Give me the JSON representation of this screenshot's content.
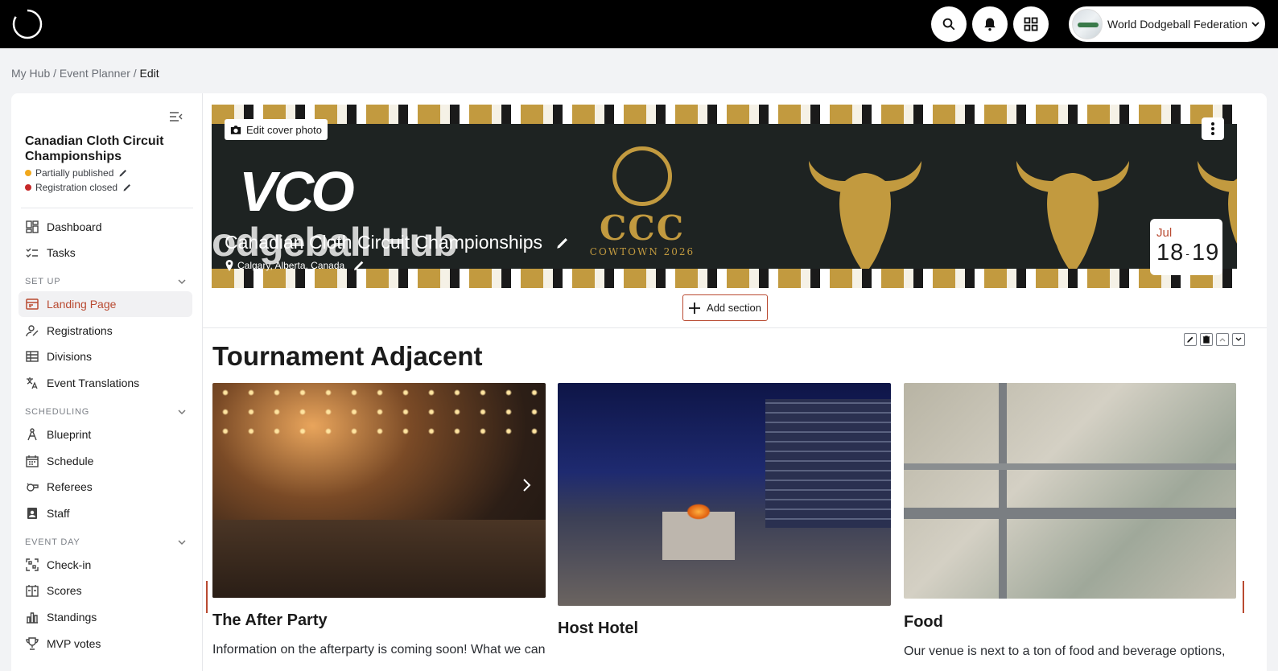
{
  "topbar": {
    "org_name": "World Dodgeball Federation",
    "icons": [
      "loading-logo-icon",
      "search-icon",
      "bell-icon",
      "apps-grid-icon",
      "chevron-down-icon"
    ]
  },
  "breadcrumb": {
    "items": [
      "My Hub",
      "Event Planner"
    ],
    "current": "Edit"
  },
  "sidebar": {
    "event_title": "Canadian Cloth Circuit Championships",
    "status_published": "Partially published",
    "status_registration": "Registration closed",
    "top_items": [
      {
        "label": "Dashboard",
        "icon": "dashboard-icon"
      },
      {
        "label": "Tasks",
        "icon": "tasks-icon"
      }
    ],
    "sections": [
      {
        "title": "SET UP",
        "items": [
          {
            "label": "Landing Page",
            "icon": "landing-page-icon",
            "active": true
          },
          {
            "label": "Registrations",
            "icon": "registrations-icon"
          },
          {
            "label": "Divisions",
            "icon": "divisions-icon"
          },
          {
            "label": "Event Translations",
            "icon": "translate-icon"
          }
        ]
      },
      {
        "title": "SCHEDULING",
        "items": [
          {
            "label": "Blueprint",
            "icon": "blueprint-icon"
          },
          {
            "label": "Schedule",
            "icon": "calendar-icon"
          },
          {
            "label": "Referees",
            "icon": "whistle-icon"
          },
          {
            "label": "Staff",
            "icon": "staff-badge-icon"
          }
        ]
      },
      {
        "title": "EVENT DAY",
        "items": [
          {
            "label": "Check-in",
            "icon": "qr-icon"
          },
          {
            "label": "Scores",
            "icon": "scoreboard-icon"
          },
          {
            "label": "Standings",
            "icon": "bar-chart-icon"
          },
          {
            "label": "MVP votes",
            "icon": "trophy-icon"
          }
        ]
      }
    ]
  },
  "cover": {
    "edit_label": "Edit cover photo",
    "event_name": "Canadian Cloth Circuit Championships",
    "location": "Calgary, Alberta, Canada",
    "date_month": "Jul",
    "date_start": "18",
    "date_sep": "-",
    "date_end": "19",
    "art_vco": "VCO",
    "art_hub": "odgeball Hub",
    "art_ccc": "CCC",
    "art_cowtown": "COWTOWN 2026",
    "colors": {
      "gold": "#c29a3f",
      "dark": "#1e2322",
      "accent": "#b94a31"
    }
  },
  "add_section_label": "Add section",
  "section": {
    "title": "Tournament Adjacent",
    "columns": [
      {
        "title": "The After Party",
        "text": "Information on the afterparty is coming soon! What we can"
      },
      {
        "title": "Host Hotel",
        "text": ""
      },
      {
        "title": "Food",
        "text": "Our venue is next to a ton of food and beverage options,"
      }
    ]
  }
}
